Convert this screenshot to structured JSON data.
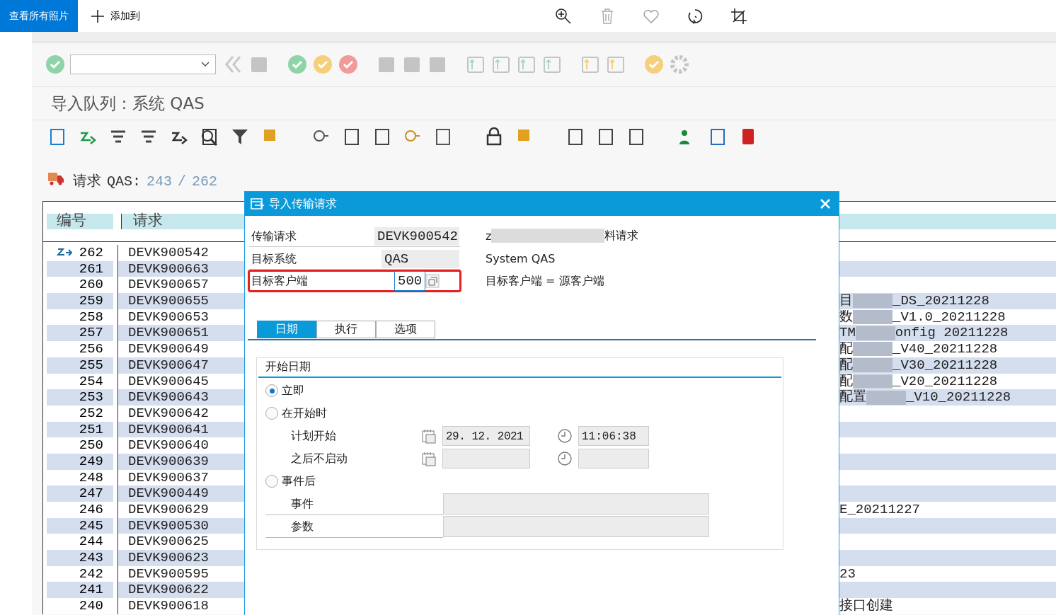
{
  "photo_bar": {
    "view_all": "查看所有照片",
    "add_to": "添加到"
  },
  "screen_title": "导入队列：系统 QAS",
  "request_header": {
    "label": "请求",
    "system": "QAS:",
    "current": "243",
    "separator": "/",
    "total": "262"
  },
  "table": {
    "columns": [
      "编号",
      "请求"
    ],
    "rows": [
      {
        "number": "262",
        "request": "DEVK900542",
        "current": true
      },
      {
        "number": "261",
        "request": "DEVK900663",
        "current": false
      },
      {
        "number": "260",
        "request": "DEVK900657",
        "current": false
      },
      {
        "number": "259",
        "request": "DEVK900655",
        "current": false,
        "trailing": [
          "目",
          "_DS_20211228"
        ]
      },
      {
        "number": "258",
        "request": "DEVK900653",
        "current": false,
        "trailing": [
          "数",
          "_V1.0_20211228"
        ]
      },
      {
        "number": "257",
        "request": "DEVK900651",
        "current": false,
        "trailing": [
          "TM",
          "onfig 20211228"
        ]
      },
      {
        "number": "256",
        "request": "DEVK900649",
        "current": false,
        "trailing": [
          "配",
          "_V40_20211228"
        ]
      },
      {
        "number": "255",
        "request": "DEVK900647",
        "current": false,
        "trailing": [
          "配",
          "_V30_20211228"
        ]
      },
      {
        "number": "254",
        "request": "DEVK900645",
        "current": false,
        "trailing": [
          "配",
          "_V20_20211228"
        ]
      },
      {
        "number": "253",
        "request": "DEVK900643",
        "current": false,
        "trailing": [
          "配置",
          "_V10_20211228"
        ]
      },
      {
        "number": "252",
        "request": "DEVK900642",
        "current": false
      },
      {
        "number": "251",
        "request": "DEVK900641",
        "current": false
      },
      {
        "number": "250",
        "request": "DEVK900640",
        "current": false
      },
      {
        "number": "249",
        "request": "DEVK900639",
        "current": false
      },
      {
        "number": "248",
        "request": "DEVK900637",
        "current": false
      },
      {
        "number": "247",
        "request": "DEVK900449",
        "current": false
      },
      {
        "number": "246",
        "request": "DEVK900629",
        "current": false,
        "trailing": [
          "E_20211227"
        ]
      },
      {
        "number": "245",
        "request": "DEVK900530",
        "current": false
      },
      {
        "number": "244",
        "request": "DEVK900625",
        "current": false
      },
      {
        "number": "243",
        "request": "DEVK900623",
        "current": false
      },
      {
        "number": "242",
        "request": "DEVK900595",
        "current": false,
        "trailing": [
          "23"
        ]
      },
      {
        "number": "241",
        "request": "DEVK900622",
        "current": false
      },
      {
        "number": "240",
        "request": "DEVK900618",
        "current": false,
        "trailing": [
          "接口创建"
        ]
      }
    ]
  },
  "dialog": {
    "title": "导入传输请求",
    "fields": [
      {
        "label": "传输请求",
        "value": "DEVK900542",
        "kind": "readonly",
        "highlighted": false,
        "description": [
          "z",
          "料请求"
        ]
      },
      {
        "label": "目标系统",
        "value": "QAS",
        "kind": "readonly",
        "highlighted": false,
        "description": [
          "System QAS"
        ]
      },
      {
        "label": "目标客户端",
        "value": "500",
        "kind": "input",
        "highlighted": true,
        "description": [
          "目标客户端 = 源客户端"
        ]
      }
    ],
    "tabs": [
      {
        "label": "日期",
        "selected": true
      },
      {
        "label": "执行",
        "selected": false
      },
      {
        "label": "选项",
        "selected": false
      }
    ],
    "group": {
      "title": "开始日期",
      "items": [
        {
          "kind": "radio",
          "label": "立即",
          "selected": true
        },
        {
          "kind": "radio",
          "label": "在开始时",
          "selected": false
        },
        {
          "kind": "datetime",
          "label": "计划开始",
          "date": "29. 12. 2021",
          "time": "11:06:38"
        },
        {
          "kind": "datetime",
          "label": "之后不启动"
        },
        {
          "kind": "radio",
          "label": "事件后",
          "selected": false
        },
        {
          "kind": "text",
          "label": "事件"
        },
        {
          "kind": "text",
          "label": "参数"
        }
      ]
    }
  }
}
